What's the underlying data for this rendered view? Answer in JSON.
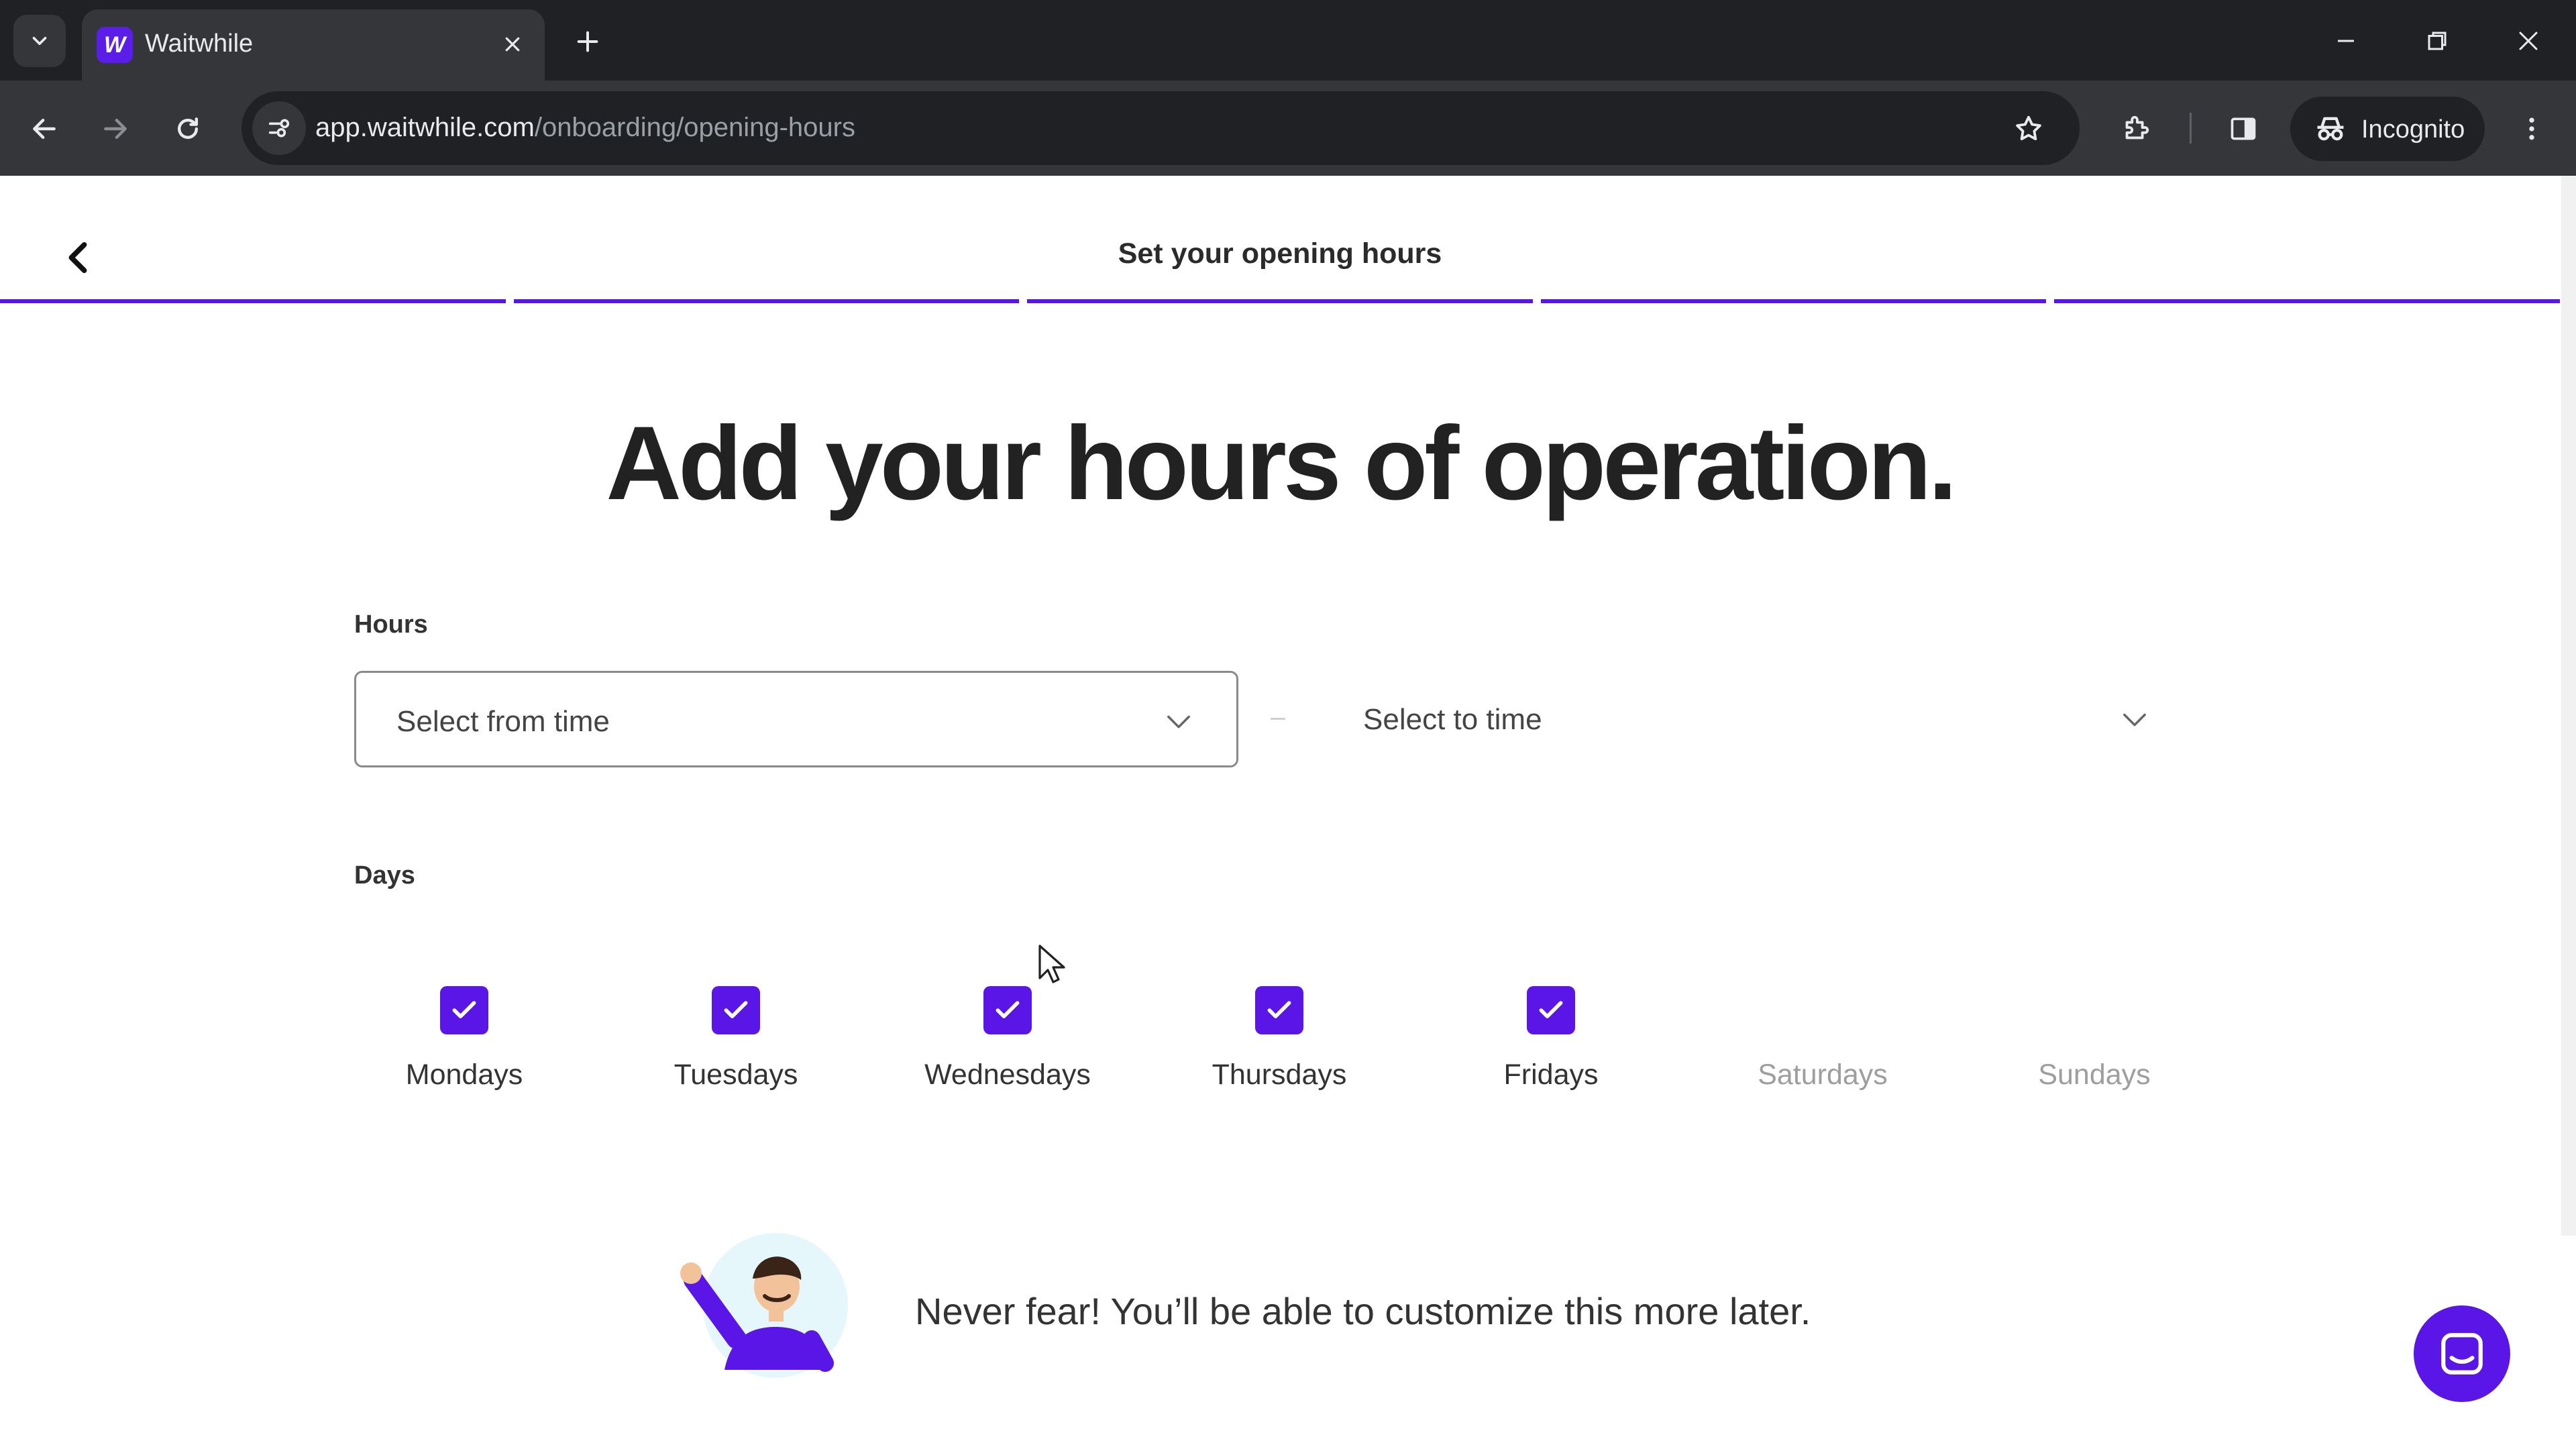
{
  "browser": {
    "tab_title": "Waitwhile",
    "favicon_letter": "W",
    "url_host": "app.waitwhile.com",
    "url_path": "/onboarding/opening-hours",
    "profile_label": "Incognito"
  },
  "header": {
    "title": "Set your opening hours",
    "progress_segments": 5,
    "progress_filled": 5
  },
  "main": {
    "headline": "Add your hours of operation.",
    "hours_label": "Hours",
    "from_placeholder": "Select from time",
    "to_placeholder": "Select to time",
    "days_label": "Days",
    "days": [
      {
        "label": "Mondays",
        "checked": true
      },
      {
        "label": "Tuesdays",
        "checked": true
      },
      {
        "label": "Wednesdays",
        "checked": true
      },
      {
        "label": "Thursdays",
        "checked": true
      },
      {
        "label": "Fridays",
        "checked": true
      },
      {
        "label": "Saturdays",
        "checked": false
      },
      {
        "label": "Sundays",
        "checked": false
      }
    ],
    "note": "Never fear! You’ll be able to customize this more later."
  },
  "colors": {
    "brand": "#5a16e6",
    "chrome_dark": "#202124",
    "chrome_toolbar": "#35363a"
  },
  "icons": [
    "tab-search-icon",
    "close-icon",
    "plus-icon",
    "minimize-icon",
    "restore-icon",
    "back-arrow-icon",
    "forward-arrow-icon",
    "reload-icon",
    "site-settings-icon",
    "star-icon",
    "extensions-icon",
    "side-panel-icon",
    "incognito-icon",
    "kebab-menu-icon",
    "chevron-left-icon",
    "chevron-down-icon",
    "checkmark-icon",
    "chat-icon"
  ]
}
